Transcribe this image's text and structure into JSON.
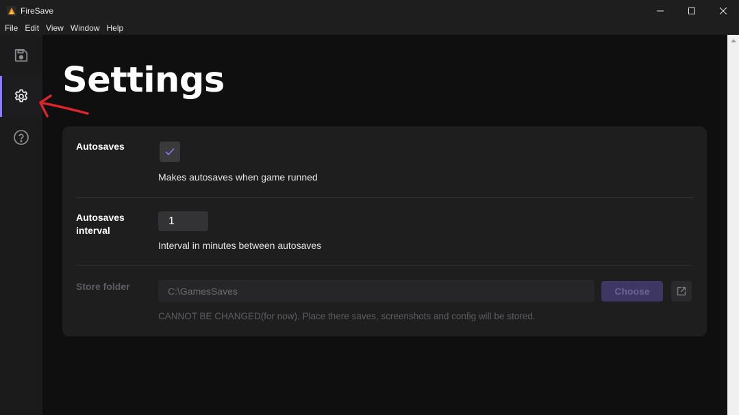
{
  "window": {
    "title": "FireSave",
    "controls": [
      "minimize-icon",
      "maximize-icon",
      "close-icon"
    ]
  },
  "menu": [
    "File",
    "Edit",
    "View",
    "Window",
    "Help"
  ],
  "sidebar": {
    "items": [
      {
        "icon": "save-icon",
        "active": false
      },
      {
        "icon": "gear-icon",
        "active": true
      },
      {
        "icon": "help-circle-icon",
        "active": false
      }
    ]
  },
  "page": {
    "title": "Settings"
  },
  "settings": {
    "autosaves": {
      "label": "Autosaves",
      "checked": true,
      "description": "Makes autosaves when game runned"
    },
    "interval": {
      "label_line1": "Autosaves",
      "label_line2": "interval",
      "value": "1",
      "description": "Interval in minutes between autosaves"
    },
    "store_folder": {
      "label": "Store folder",
      "path": "C:\\GamesSaves",
      "choose_label": "Choose",
      "open_icon": "external-link-icon",
      "description": "CANNOT BE CHANGED(for now). Place there saves, screenshots and config will be stored."
    }
  },
  "colors": {
    "accent": "#8b7cf6",
    "annotation": "#d8262c"
  }
}
